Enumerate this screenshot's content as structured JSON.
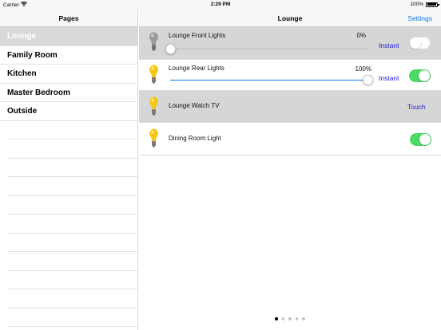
{
  "status_bar": {
    "carrier": "Carrier",
    "time": "2:29 PM",
    "battery": "100%",
    "wifi_icon": "wifi-icon",
    "battery_icon": "battery-icon"
  },
  "sidebar": {
    "title": "Pages",
    "items": [
      {
        "label": "Lounge",
        "selected": true
      },
      {
        "label": "Family Room",
        "selected": false
      },
      {
        "label": "Kitchen",
        "selected": false
      },
      {
        "label": "Master Bedroom",
        "selected": false
      },
      {
        "label": "Outside",
        "selected": false
      }
    ]
  },
  "main": {
    "title": "Lounge",
    "settings_label": "Settings",
    "devices": [
      {
        "name": "Lounge Front Lights",
        "level": "0%",
        "level_value": 0,
        "mode": "Instant",
        "on": false,
        "icon": "bulb-off-icon"
      },
      {
        "name": "Lounge Rear Lights",
        "level": "100%",
        "level_value": 100,
        "mode": "Instant",
        "on": true,
        "icon": "bulb-on-icon"
      },
      {
        "name": "Lounge Watch TV",
        "mode": "Touch",
        "icon": "bulb-on-icon"
      },
      {
        "name": "Dining Room Light",
        "on": true,
        "icon": "bulb-on-icon"
      }
    ],
    "page_indicator": {
      "pages": 5,
      "current": 1
    }
  },
  "colors": {
    "accent": "#1473e6",
    "mode_link": "#1a1ad6",
    "toggle_on": "#4cd964",
    "selected_row": "#d9d9d9",
    "scene_row": "#d6d6d6",
    "bulb_on": "#f5c518",
    "bulb_off": "#9a9a9a"
  }
}
